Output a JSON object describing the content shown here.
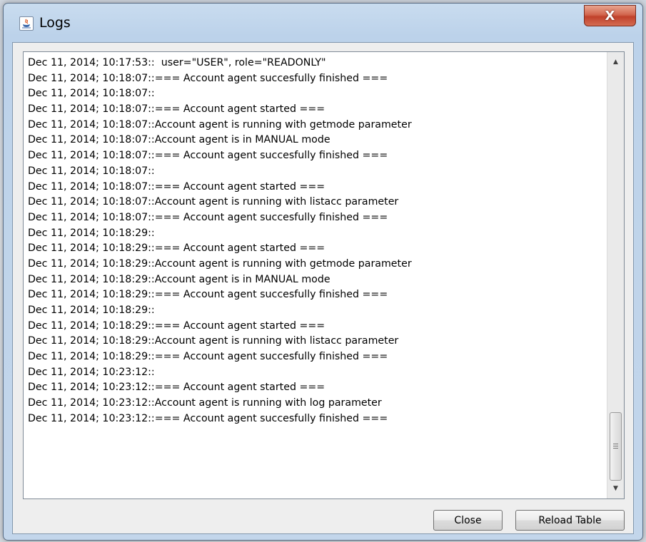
{
  "window": {
    "title": "Logs",
    "app_icon": "java-icon",
    "close_glyph": "X"
  },
  "log": {
    "lines": [
      "Dec 11, 2014; 10:17:53::  user=\"USER\", role=\"READONLY\"",
      "Dec 11, 2014; 10:18:07::=== Account agent succesfully finished ===",
      "Dec 11, 2014; 10:18:07::",
      "Dec 11, 2014; 10:18:07::=== Account agent started ===",
      "Dec 11, 2014; 10:18:07::Account agent is running with getmode parameter",
      "Dec 11, 2014; 10:18:07::Account agent is in MANUAL mode",
      "Dec 11, 2014; 10:18:07::=== Account agent succesfully finished ===",
      "Dec 11, 2014; 10:18:07::",
      "Dec 11, 2014; 10:18:07::=== Account agent started ===",
      "Dec 11, 2014; 10:18:07::Account agent is running with listacc parameter",
      "Dec 11, 2014; 10:18:07::=== Account agent succesfully finished ===",
      "Dec 11, 2014; 10:18:29::",
      "Dec 11, 2014; 10:18:29::=== Account agent started ===",
      "Dec 11, 2014; 10:18:29::Account agent is running with getmode parameter",
      "Dec 11, 2014; 10:18:29::Account agent is in MANUAL mode",
      "Dec 11, 2014; 10:18:29::=== Account agent succesfully finished ===",
      "Dec 11, 2014; 10:18:29::",
      "Dec 11, 2014; 10:18:29::=== Account agent started ===",
      "Dec 11, 2014; 10:18:29::Account agent is running with listacc parameter",
      "Dec 11, 2014; 10:18:29::=== Account agent succesfully finished ===",
      "Dec 11, 2014; 10:23:12::",
      "Dec 11, 2014; 10:23:12::=== Account agent started ===",
      "Dec 11, 2014; 10:23:12::Account agent is running with log parameter",
      "Dec 11, 2014; 10:23:12::=== Account agent succesfully finished ==="
    ],
    "scroll_position": 1.0
  },
  "buttons": {
    "close_label": "Close",
    "reload_label": "Reload Table"
  },
  "colors": {
    "title_close_red": "#c0412b",
    "window_frame": "#c3d6eb"
  }
}
